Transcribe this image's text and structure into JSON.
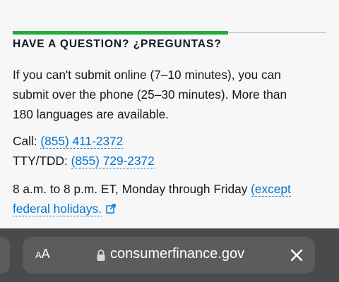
{
  "section": {
    "heading": "HAVE A QUESTION? ¿PREGUNTAS?",
    "intro_lines": [
      "If you can't submit online (7–10 minutes), you can",
      "submit over the phone (25–30 minutes). More than",
      "180 languages are available."
    ],
    "call_label": "Call:",
    "call_number": "(855) 411-2372",
    "tty_label": "TTY/TDD:",
    "tty_number": "(855) 729-2372",
    "hours_text": "8 a.m. to 8 p.m. ET, Monday through Friday",
    "holidays_link_line1": "(except",
    "holidays_link_line2": "federal holidays."
  },
  "browser": {
    "text_size_button": {
      "small": "A",
      "large": "A"
    },
    "domain": "consumerfinance.gov"
  },
  "colors": {
    "accent_green": "#20aa3f",
    "link_blue": "#0072ce",
    "toolbar_bg": "#4a4a4c"
  },
  "icons": {
    "external_link": "external-link-icon",
    "lock": "lock-icon",
    "close": "close-icon"
  }
}
